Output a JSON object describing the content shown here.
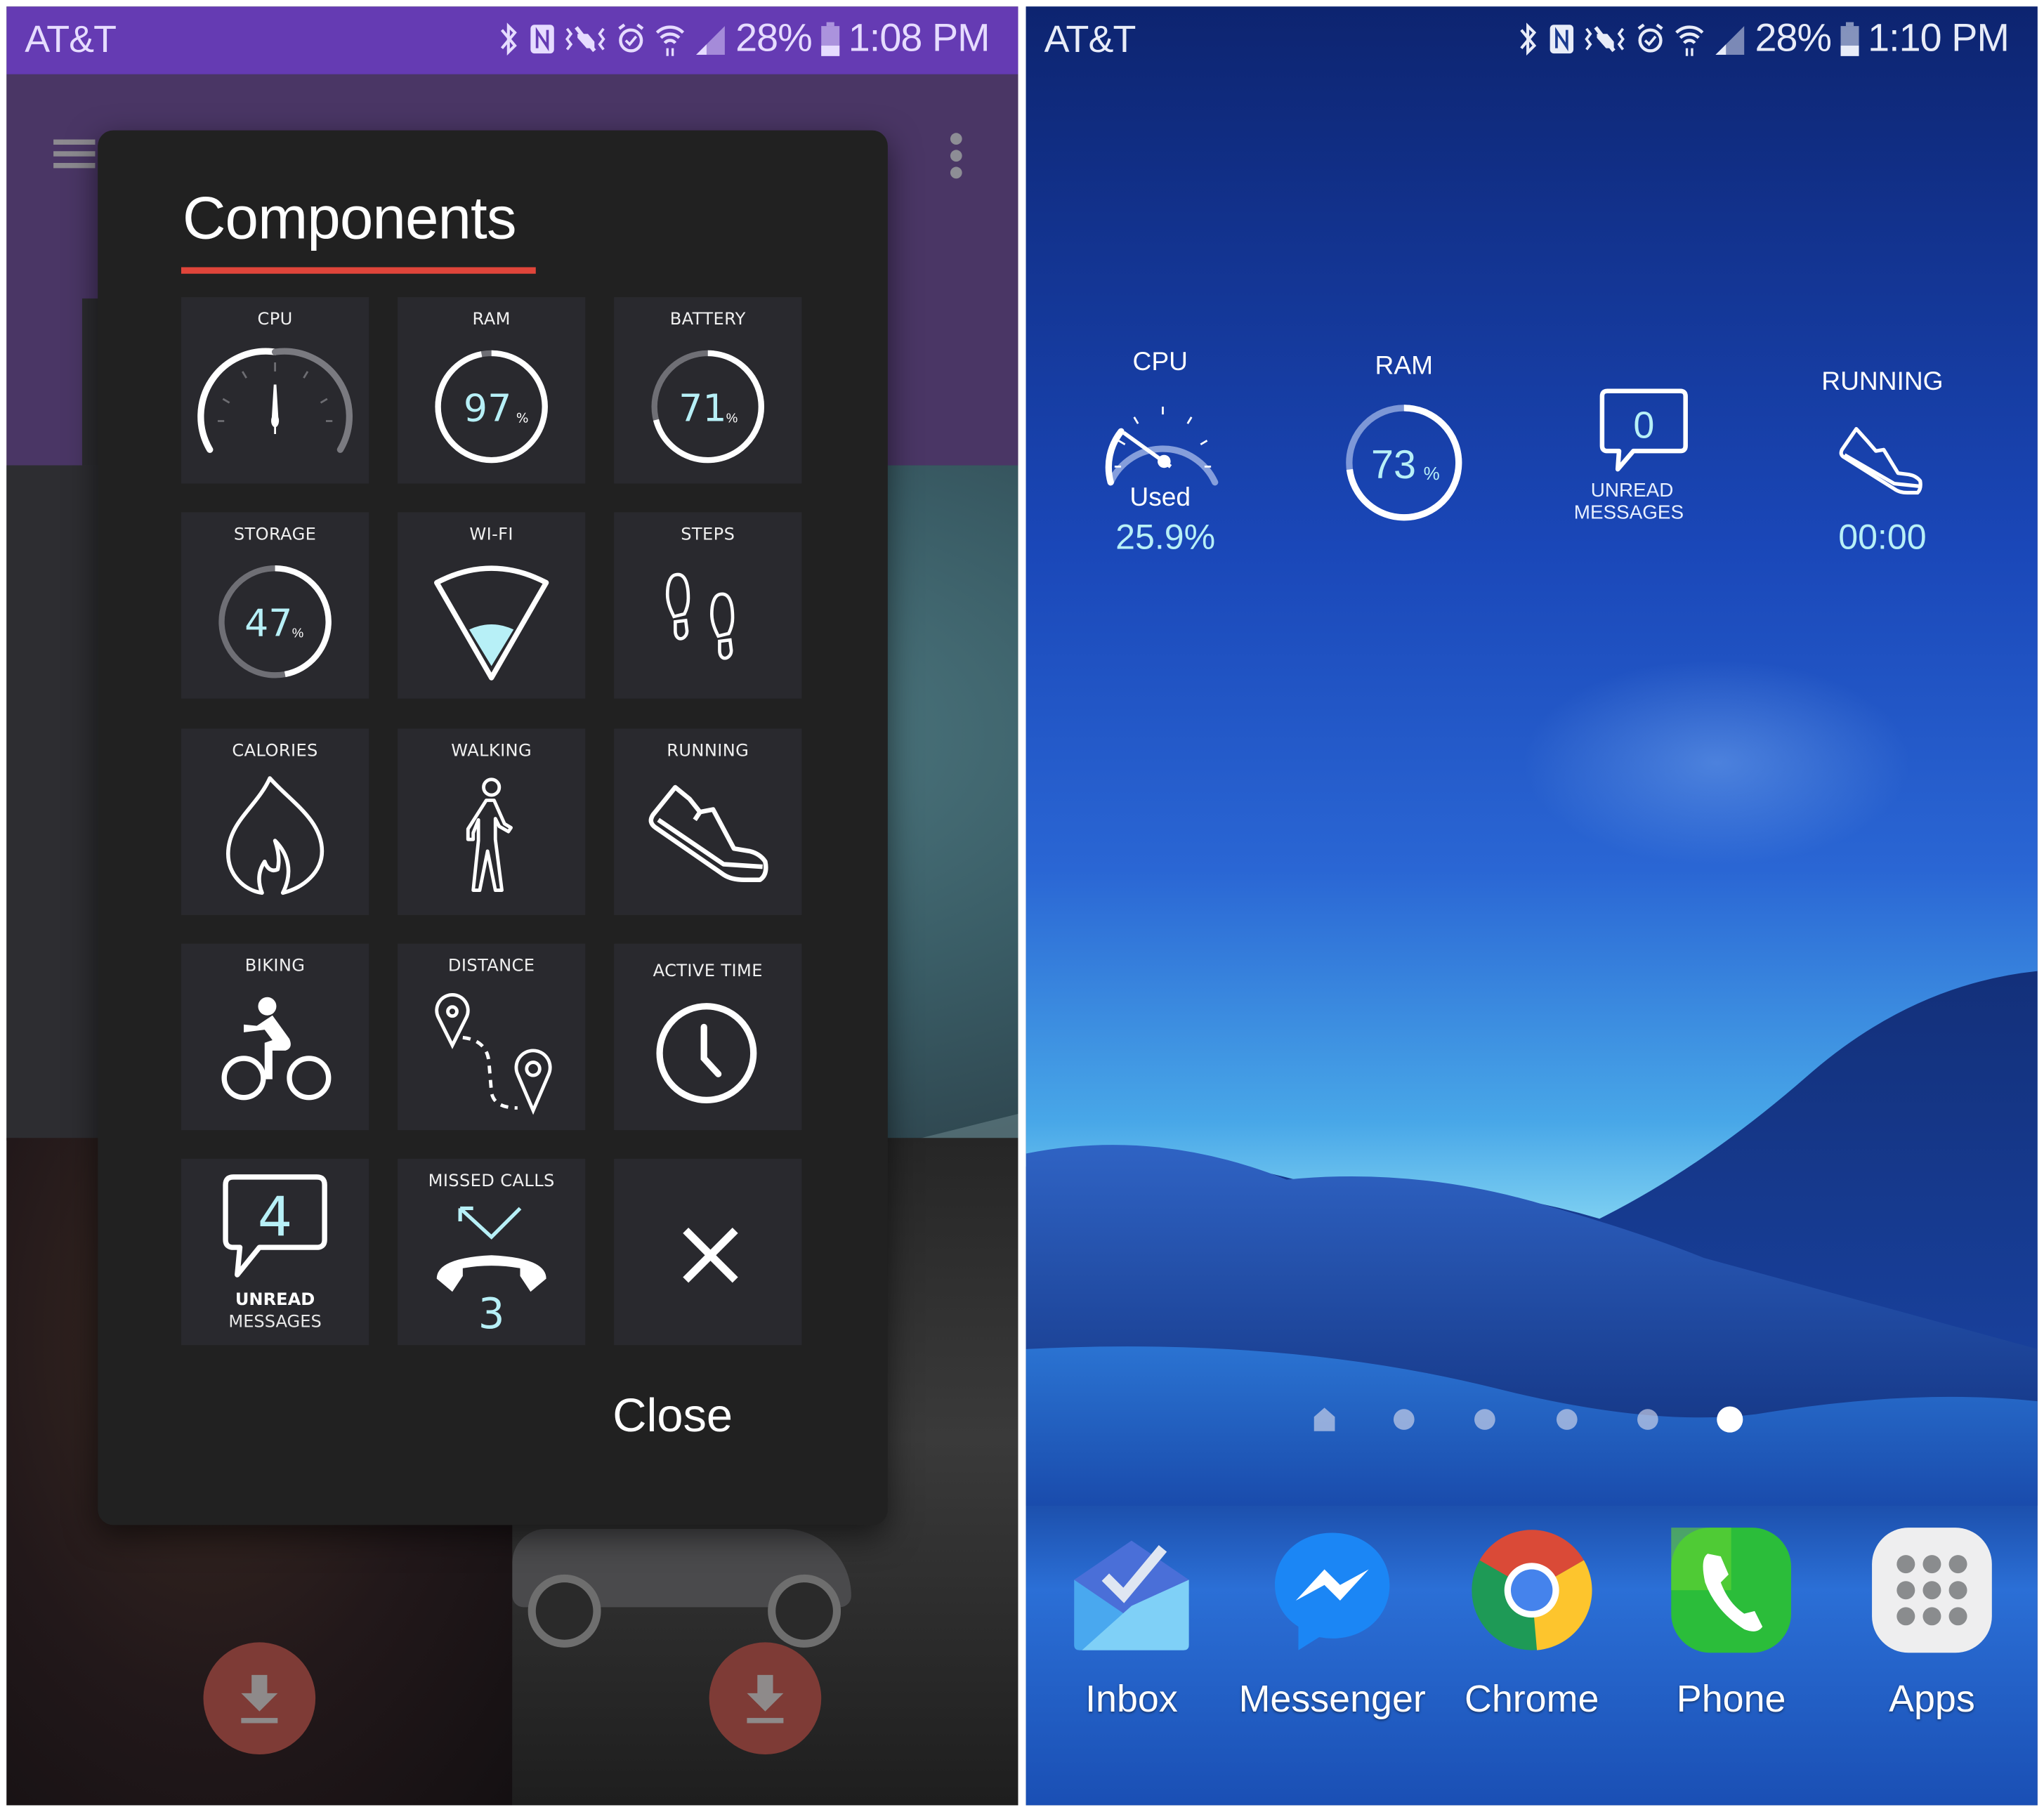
{
  "left_screen": {
    "status_bar": {
      "carrier": "AT&T",
      "icons": [
        "bluetooth-icon",
        "nfc-icon",
        "vibrate-icon",
        "alarm-icon",
        "wifi-icon",
        "signal-icon"
      ],
      "battery_percent": "28%",
      "time": "1:08 PM"
    },
    "dialog": {
      "title": "Components",
      "tiles": [
        {
          "label": "CPU",
          "icon": "speedometer-gauge"
        },
        {
          "label": "RAM",
          "value": "97",
          "unit": "%",
          "level": 0.97
        },
        {
          "label": "BATTERY",
          "value": "71",
          "unit": "%",
          "level": 0.71
        },
        {
          "label": "STORAGE",
          "value": "47",
          "unit": "%",
          "level": 0.47
        },
        {
          "label": "WI-FI",
          "icon": "wifi-cone"
        },
        {
          "label": "STEPS",
          "icon": "footprints"
        },
        {
          "label": "CALORIES",
          "icon": "flame"
        },
        {
          "label": "WALKING",
          "icon": "walking-person"
        },
        {
          "label": "RUNNING",
          "icon": "running-shoe"
        },
        {
          "label": "BIKING",
          "icon": "cyclist"
        },
        {
          "label": "DISTANCE",
          "icon": "map-pins-route"
        },
        {
          "label": "ACTIVE TIME",
          "icon": "clock"
        },
        {
          "label_line1": "UNREAD",
          "label_line2": "MESSAGES",
          "value": "4",
          "icon": "chat-bubble"
        },
        {
          "label": "MISSED CALLS",
          "value": "3",
          "icon": "missed-call"
        },
        {
          "icon": "close-x"
        }
      ],
      "close_button": "Close"
    },
    "accent_colors": {
      "status_bar": "#653bb3",
      "toolbar": "#4a3665",
      "underline": "#e0453a",
      "value_text": "#b7f0f7",
      "fab": "#7e3b36"
    }
  },
  "right_screen": {
    "status_bar": {
      "carrier": "AT&T",
      "icons": [
        "bluetooth-icon",
        "nfc-icon",
        "vibrate-icon",
        "alarm-icon",
        "wifi-icon",
        "signal-icon"
      ],
      "battery_percent": "28%",
      "time": "1:10 PM"
    },
    "widgets": {
      "cpu": {
        "label": "CPU",
        "caption": "Used",
        "value": "25.9%",
        "level": 0.259
      },
      "ram": {
        "label": "RAM",
        "value": "73",
        "unit": "%",
        "level": 0.73
      },
      "messages": {
        "count": "0",
        "line1": "UNREAD",
        "line2": "MESSAGES"
      },
      "running": {
        "label": "RUNNING",
        "value": "00:00"
      }
    },
    "page_indicator": {
      "pages": 6,
      "current": 6,
      "first_is_home": true
    },
    "dock": [
      {
        "label": "Inbox",
        "icon": "inbox-icon"
      },
      {
        "label": "Messenger",
        "icon": "messenger-icon"
      },
      {
        "label": "Chrome",
        "icon": "chrome-icon"
      },
      {
        "label": "Phone",
        "icon": "phone-icon"
      },
      {
        "label": "Apps",
        "icon": "apps-grid-icon"
      }
    ]
  }
}
